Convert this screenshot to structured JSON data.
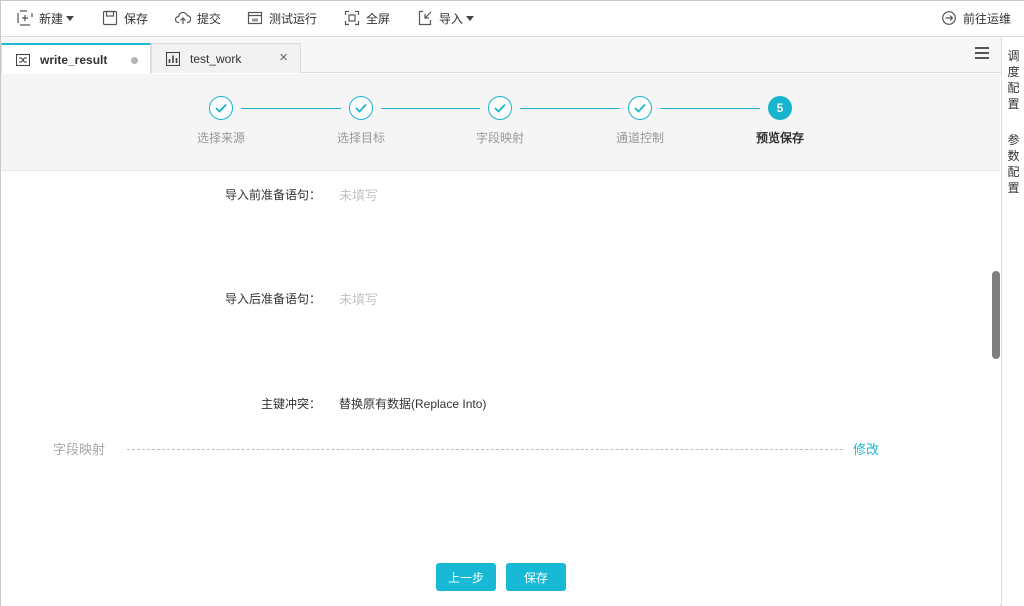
{
  "toolbar": {
    "new_label": "新建",
    "save_label": "保存",
    "submit_label": "提交",
    "test_run_label": "测试运行",
    "fullscreen_label": "全屏",
    "import_label": "导入",
    "goto_ops_label": "前往运维"
  },
  "tabs": [
    {
      "label": "write_result",
      "active": true,
      "modified": true
    },
    {
      "label": "test_work",
      "active": false,
      "modified": false
    }
  ],
  "sidebar": {
    "schedule_config": [
      "调",
      "度",
      "配",
      "置"
    ],
    "param_config": [
      "参",
      "数",
      "配",
      "置"
    ]
  },
  "steps": [
    {
      "label": "选择来源",
      "state": "done"
    },
    {
      "label": "选择目标",
      "state": "done"
    },
    {
      "label": "字段映射",
      "state": "done"
    },
    {
      "label": "通道控制",
      "state": "done"
    },
    {
      "label": "预览保存",
      "state": "current",
      "number": "5"
    }
  ],
  "form": {
    "pre_sql_label": "导入前准备语句：",
    "pre_sql_value": "未填写",
    "post_sql_label": "导入后准备语句：",
    "post_sql_value": "未填写",
    "pk_conflict_label": "主键冲突：",
    "pk_conflict_value": "替换原有数据(Replace Into)"
  },
  "field_mapping": {
    "title": "字段映射",
    "edit_label": "修改"
  },
  "footer": {
    "prev_label": "上一步",
    "save_label": "保存"
  },
  "colors": {
    "accent": "#17b4cf",
    "placeholder": "#c4c4c4"
  }
}
